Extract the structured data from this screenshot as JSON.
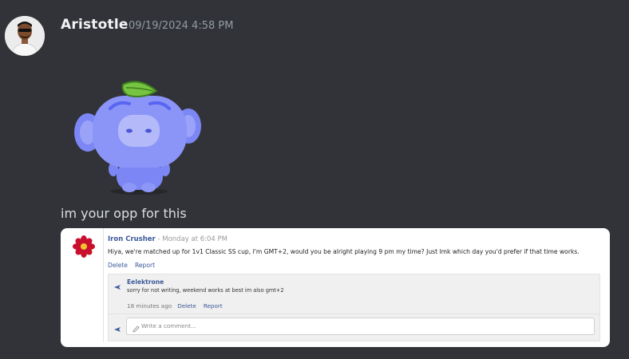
{
  "message": {
    "username": "Aristotle",
    "timestamp": "09/19/2024 4:58 PM",
    "text": "im your opp for this"
  },
  "embed": {
    "comment": {
      "author": "Iron Crusher",
      "separator": " - ",
      "time": "Monday at 6:04 PM",
      "body": "Hiya, we're matched up for 1v1 Classic SS cup, I'm GMT+2, would you be alright playing 9 pm my time? Just lmk which day you'd prefer if that time works.",
      "delete_label": "Delete",
      "report_label": "Report"
    },
    "reply": {
      "author": "Eelektrone",
      "body": "sorry for not writing, weekend works at best im also gmt+2",
      "time": "18 minutes ago",
      "delete_label": "Delete",
      "report_label": "Report"
    },
    "write_placeholder": "Write a comment..."
  },
  "icons": {
    "avatar": "user-avatar",
    "sticker": "wumpus-leaf-sticker",
    "author_avatar": "red-flower-icon",
    "reply": "reply-arrow-icon",
    "pencil": "pencil-icon"
  },
  "colors": {
    "background": "#313338",
    "username": "#f2f3f5",
    "timestamp": "#949ba4",
    "link": "#3b5998",
    "wumpus": "#7c87f5"
  }
}
